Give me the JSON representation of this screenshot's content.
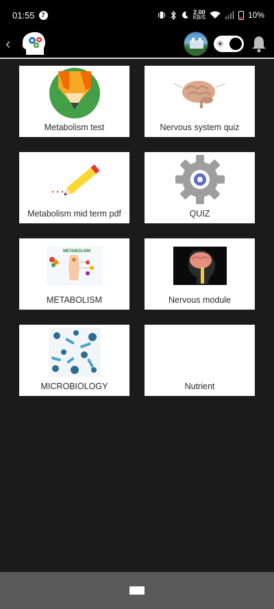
{
  "status_bar": {
    "time": "01:55",
    "notification_badge": "7",
    "net_speed_value": "2.00",
    "net_speed_unit": "KB/S",
    "battery": "10%"
  },
  "app_bar": {
    "back_icon": "chevron-left-icon",
    "logo_icon": "head-gears-icon",
    "toggle_icon": "sun-icon",
    "bell_icon": "bell-icon"
  },
  "tiles": [
    {
      "label": "Metabolism test",
      "icon": "pencil-badge-icon"
    },
    {
      "label": "Nervous system quiz",
      "icon": "brain-icon"
    },
    {
      "label": "Metabolism mid term pdf",
      "icon": "pencil-icon"
    },
    {
      "label": "QUIZ",
      "icon": "gear-icon"
    },
    {
      "label": "METABOLISM",
      "icon": "metabolism-image",
      "image_title": "METABOLISM"
    },
    {
      "label": "Nervous module",
      "icon": "brain-xray-image"
    },
    {
      "label": "MICROBIOLOGY",
      "icon": "microbes-image"
    },
    {
      "label": "Nutrient",
      "icon": ""
    }
  ],
  "colors": {
    "background": "#1b1b1b",
    "bar": "#000000",
    "tile": "#ffffff",
    "nav": "#5a5a5a"
  }
}
